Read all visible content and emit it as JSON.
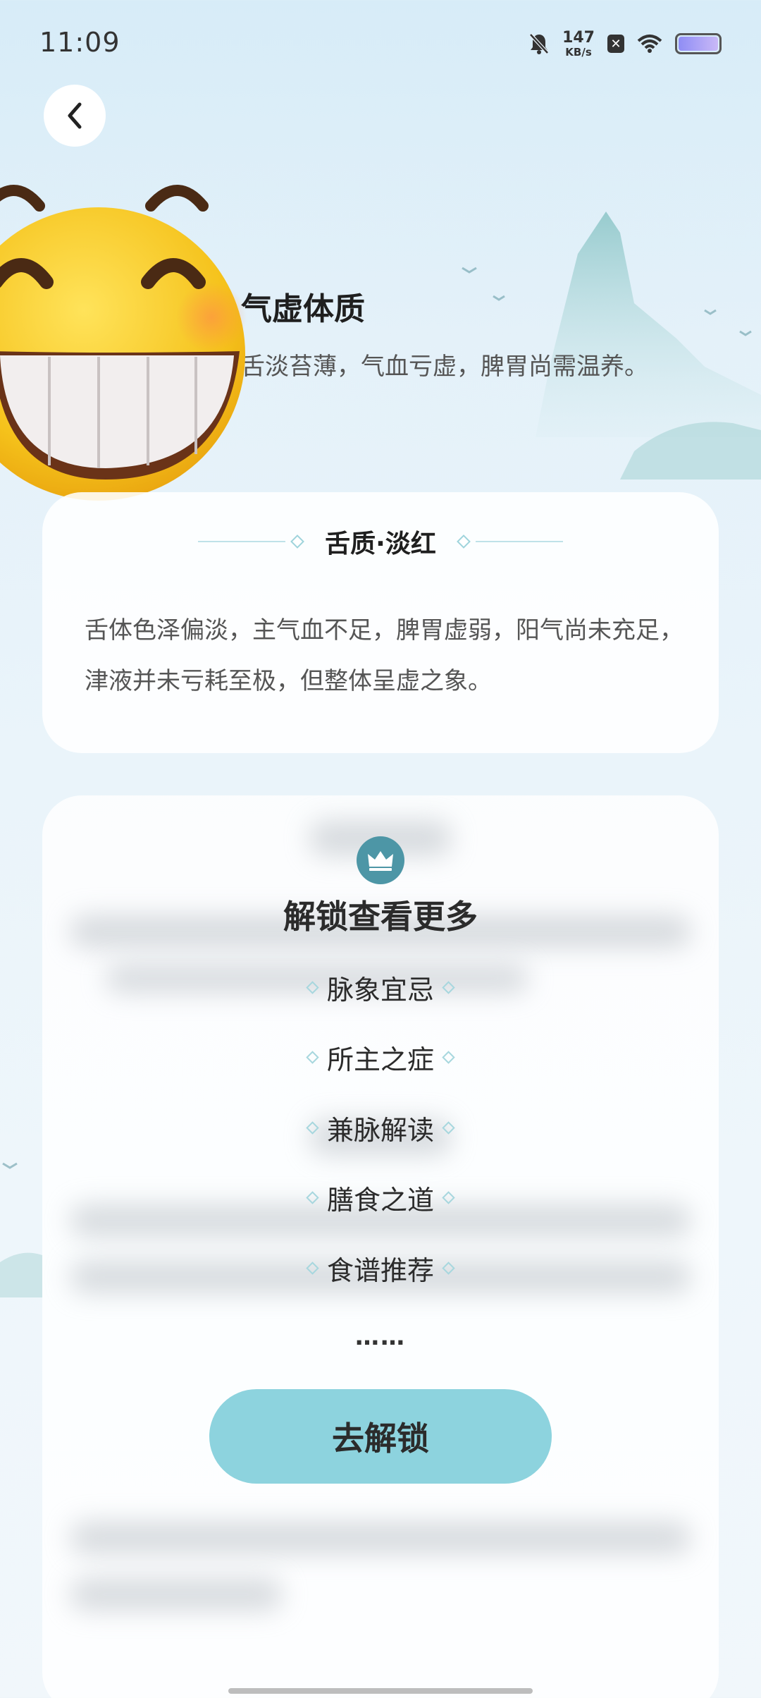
{
  "status_bar": {
    "time": "11:09",
    "net_speed_value": "147",
    "net_speed_unit": "KB/s",
    "icons": [
      "bell-off-icon",
      "netspeed-indicator",
      "x-app-icon",
      "wifi-icon",
      "battery-icon"
    ]
  },
  "header": {
    "back_icon": "chevron-left-icon",
    "result_title": "气虚体质",
    "result_desc": "舌淡苔薄，气血亏虚，脾胃尚需温养。"
  },
  "tongue_card": {
    "title": "舌质·淡红",
    "description": "舌体色泽偏淡，主气血不足，脾胃虚弱，阳气尚未充足，津液并未亏耗至极，但整体呈虚之象。"
  },
  "locked_card": {
    "icon": "crown-icon",
    "title": "解锁查看更多",
    "items": [
      "脉象宜忌",
      "所主之症",
      "兼脉解读",
      "膳食之道",
      "食谱推荐"
    ],
    "ellipsis": "……",
    "button_label": "去解锁"
  },
  "colors": {
    "accent": "#8dd3de",
    "crown_bg": "#4d96a6",
    "emoji_yellow": "#f5c21b"
  }
}
